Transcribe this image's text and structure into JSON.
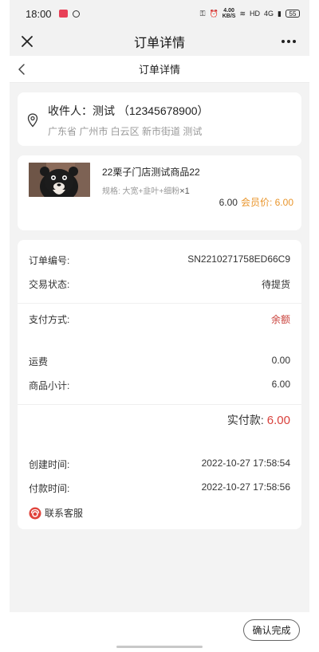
{
  "status_bar": {
    "time": "18:00",
    "net_speed_value": "4.00",
    "net_speed_unit": "KB/S",
    "network_label": "HD",
    "signal_label": "4G",
    "battery": "55"
  },
  "app_bar": {
    "title": "订单详情"
  },
  "nav": {
    "title": "订单详情"
  },
  "address": {
    "receiver": "收件人：测试 （12345678900）",
    "detail": "广东省 广州市 白云区 新市街道 测试"
  },
  "goods": {
    "name": "22栗子门店测试商品22",
    "spec": "规格: 大宽+韭叶+细粉",
    "quantity": "×1",
    "price": "6.00",
    "member_price": "会员价: 6.00"
  },
  "order": {
    "number_label": "订单编号:",
    "number": "SN2210271758ED66C9",
    "status_label": "交易状态:",
    "status": "待提货",
    "payment_label": "支付方式:",
    "payment": "余额",
    "shipping_label": "运费",
    "shipping": "0.00",
    "subtotal_label": "商品小计:",
    "subtotal": "6.00",
    "paid_label": "实付款:",
    "paid": "6.00",
    "created_label": "创建时间:",
    "created": "2022-10-27 17:58:54",
    "paytime_label": "付款时间:",
    "paytime": "2022-10-27 17:58:56",
    "service_label": "联系客服"
  },
  "bottom": {
    "confirm_label": "确认完成"
  },
  "colors": {
    "accent_red": "#d9413c",
    "member_orange": "#e9952b",
    "page_bg": "#f3f3f3"
  },
  "icons": [
    "close-icon",
    "more-icon",
    "back-icon",
    "location-pin-icon",
    "customer-service-icon"
  ]
}
